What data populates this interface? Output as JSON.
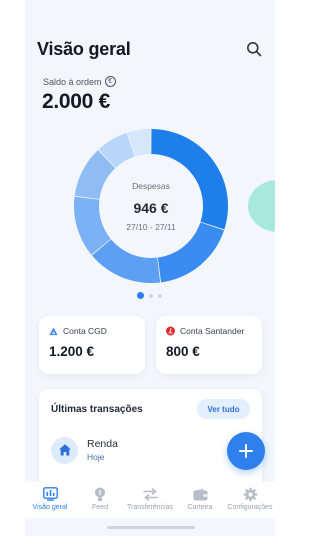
{
  "header": {
    "title": "Visão geral",
    "search_icon": "search-icon"
  },
  "balance": {
    "label": "Saldo à ordem",
    "currency_symbol": "€",
    "value": "2.000 €"
  },
  "donut": {
    "caption": "Despesas",
    "amount": "946 €",
    "period": "27/10 - 27/11",
    "segments": [
      {
        "fraction": 0.3,
        "color": "#1f7fea"
      },
      {
        "fraction": 0.18,
        "color": "#3b8cf0"
      },
      {
        "fraction": 0.16,
        "color": "#5d9ff2"
      },
      {
        "fraction": 0.13,
        "color": "#7ab2f5"
      },
      {
        "fraction": 0.11,
        "color": "#8fbdf3"
      },
      {
        "fraction": 0.07,
        "color": "#b8d6f9"
      },
      {
        "fraction": 0.05,
        "color": "#d6e6fb"
      }
    ]
  },
  "pager": {
    "count": 3,
    "active": 0
  },
  "accounts": [
    {
      "name": "Conta CGD",
      "amount": "1.200 €",
      "icon": "cgd-logo-icon",
      "color": "#3b82f6"
    },
    {
      "name": "Conta Santander",
      "amount": "800 €",
      "icon": "santander-logo-icon",
      "color": "#e02d2d"
    }
  ],
  "transactions": {
    "title": "Últimas transações",
    "see_all_label": "Ver tudo",
    "items": [
      {
        "name": "Renda",
        "date": "Hoje",
        "icon": "house-icon"
      }
    ]
  },
  "fab": {
    "icon": "plus-icon"
  },
  "tabbar": {
    "items": [
      {
        "label": "Visão geral",
        "icon": "dashboard-icon",
        "active": true
      },
      {
        "label": "Feed",
        "icon": "lightbulb-icon",
        "active": false
      },
      {
        "label": "Transferências",
        "icon": "transfer-arrows-icon",
        "active": false
      },
      {
        "label": "Carteira",
        "icon": "wallet-icon",
        "active": false
      },
      {
        "label": "Configurações",
        "icon": "gear-icon",
        "active": false
      }
    ]
  },
  "colors": {
    "accent": "#2f80ed",
    "background": "#f3f6fb",
    "decor_green": "#a8ead9"
  }
}
